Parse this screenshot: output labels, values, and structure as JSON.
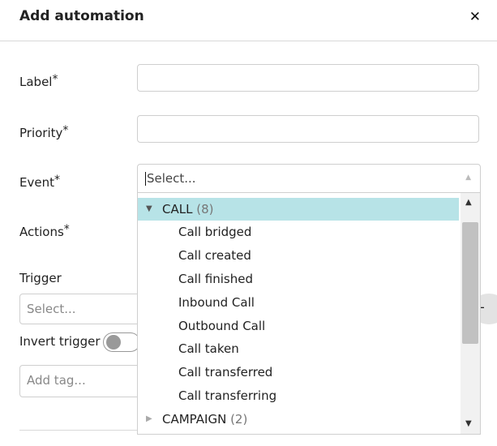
{
  "header": {
    "title": "Add automation",
    "close_icon": "close-icon"
  },
  "form": {
    "label": {
      "text": "Label",
      "required": "*",
      "value": ""
    },
    "priority": {
      "text": "Priority",
      "required": "*",
      "value": ""
    },
    "event": {
      "text": "Event",
      "required": "*",
      "placeholder": "Select..."
    },
    "actions": {
      "text": "Actions",
      "required": "*"
    },
    "trigger": {
      "text": "Trigger",
      "placeholder": "Select..."
    },
    "invert_trigger": {
      "text": "Invert trigger",
      "checked": false
    },
    "tags": {
      "placeholder": "Add tag..."
    }
  },
  "dropdown": {
    "groups": [
      {
        "label": "CALL",
        "count": "(8)",
        "expanded": true,
        "items": [
          "Call bridged",
          "Call created",
          "Call finished",
          "Inbound Call",
          "Outbound Call",
          "Call taken",
          "Call transferred",
          "Call transferring"
        ]
      },
      {
        "label": "CAMPAIGN",
        "count": "(2)",
        "expanded": false,
        "items": []
      }
    ]
  },
  "colors": {
    "active_group_bg": "#b7e3e7",
    "border": "#cfcfcf"
  }
}
